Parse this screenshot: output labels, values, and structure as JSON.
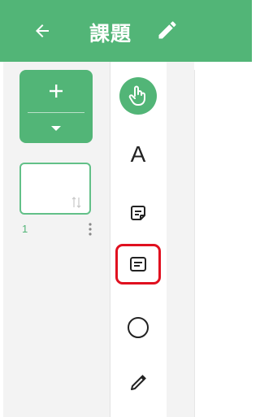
{
  "header": {
    "back_icon": "arrow-left-icon",
    "title": "課題",
    "edit_icon": "pencil-icon",
    "background": "#52b577"
  },
  "page_panel": {
    "add_icon": "plus-icon",
    "dropdown_icon": "caret-down-icon",
    "pages": [
      {
        "number": "1",
        "sort_icon": "sort-arrows-icon",
        "menu_icon": "more-vertical-icon"
      }
    ]
  },
  "tools": [
    {
      "name": "pointer",
      "icon": "hand-pointer-icon",
      "active": true
    },
    {
      "name": "text",
      "label": "A"
    },
    {
      "name": "sticky-note",
      "icon": "sticky-note-icon"
    },
    {
      "name": "text-box",
      "icon": "text-box-icon",
      "highlighted": true,
      "highlight_color": "#e0101f"
    },
    {
      "name": "shape",
      "icon": "circle-icon"
    },
    {
      "name": "pen",
      "icon": "pencil-icon"
    }
  ]
}
